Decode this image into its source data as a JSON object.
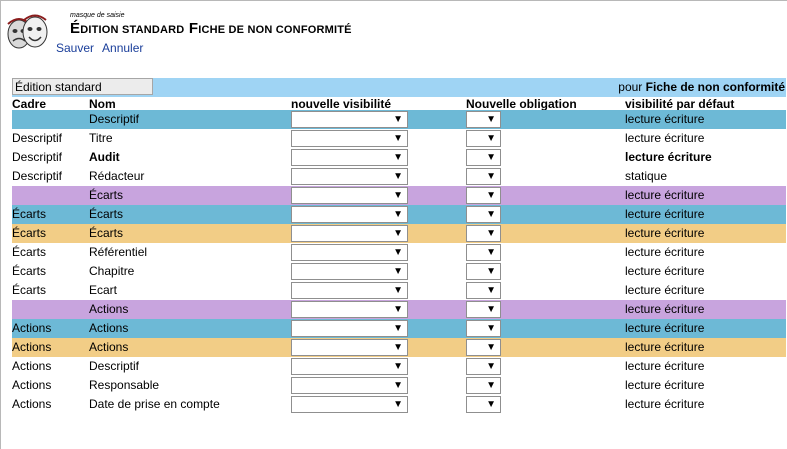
{
  "header": {
    "caption": "masque de saisie",
    "title_e_initial": "É",
    "title_e_rest": "DITION STANDARD",
    "title_f_initial": "F",
    "title_f_rest": "ICHE DE NON CONFORMITÉ",
    "save_label": "Sauver",
    "cancel_label": "Annuler"
  },
  "mode": {
    "input_value": "Édition standard",
    "pour_label": "pour",
    "form_name": "Fiche de non conformité"
  },
  "columns": {
    "cadre": "Cadre",
    "nom": "Nom",
    "nouvelle_visibilite": "nouvelle visibilité",
    "nouvelle_obligation": "Nouvelle obligation",
    "visibilite_defaut": "visibilité par défaut"
  },
  "select_arrow": "▼",
  "rows": [
    {
      "bg": "blue",
      "cadre": "",
      "nom": "Descriptif",
      "defaut": "lecture écriture",
      "bold": false
    },
    {
      "bg": "white",
      "cadre": "Descriptif",
      "nom": "Titre",
      "defaut": "lecture écriture",
      "bold": false
    },
    {
      "bg": "white",
      "cadre": "Descriptif",
      "nom": "Audit",
      "defaut": "lecture écriture",
      "bold": true
    },
    {
      "bg": "white",
      "cadre": "Descriptif",
      "nom": "Rédacteur",
      "defaut": "statique",
      "bold": false
    },
    {
      "bg": "purple",
      "cadre": "",
      "nom": "Écarts",
      "defaut": "lecture écriture",
      "bold": false
    },
    {
      "bg": "blue",
      "cadre": "Écarts",
      "nom": "Écarts",
      "defaut": "lecture écriture",
      "bold": false
    },
    {
      "bg": "orange",
      "cadre": "Écarts",
      "nom": "Écarts",
      "defaut": "lecture écriture",
      "bold": false
    },
    {
      "bg": "white",
      "cadre": "Écarts",
      "nom": "Référentiel",
      "defaut": "lecture écriture",
      "bold": false
    },
    {
      "bg": "white",
      "cadre": "Écarts",
      "nom": "Chapitre",
      "defaut": "lecture écriture",
      "bold": false
    },
    {
      "bg": "white",
      "cadre": "Écarts",
      "nom": "Ecart",
      "defaut": "lecture écriture",
      "bold": false
    },
    {
      "bg": "purple",
      "cadre": "",
      "nom": "Actions",
      "defaut": "lecture écriture",
      "bold": false
    },
    {
      "bg": "blue",
      "cadre": "Actions",
      "nom": "Actions",
      "defaut": "lecture écriture",
      "bold": false
    },
    {
      "bg": "orange",
      "cadre": "Actions",
      "nom": "Actions",
      "defaut": "lecture écriture",
      "bold": false
    },
    {
      "bg": "white",
      "cadre": "Actions",
      "nom": "Descriptif",
      "defaut": "lecture écriture",
      "bold": false
    },
    {
      "bg": "white",
      "cadre": "Actions",
      "nom": "Responsable",
      "defaut": "lecture écriture",
      "bold": false
    },
    {
      "bg": "white",
      "cadre": "Actions",
      "nom": "Date de prise en compte",
      "defaut": "lecture écriture",
      "bold": false
    }
  ]
}
